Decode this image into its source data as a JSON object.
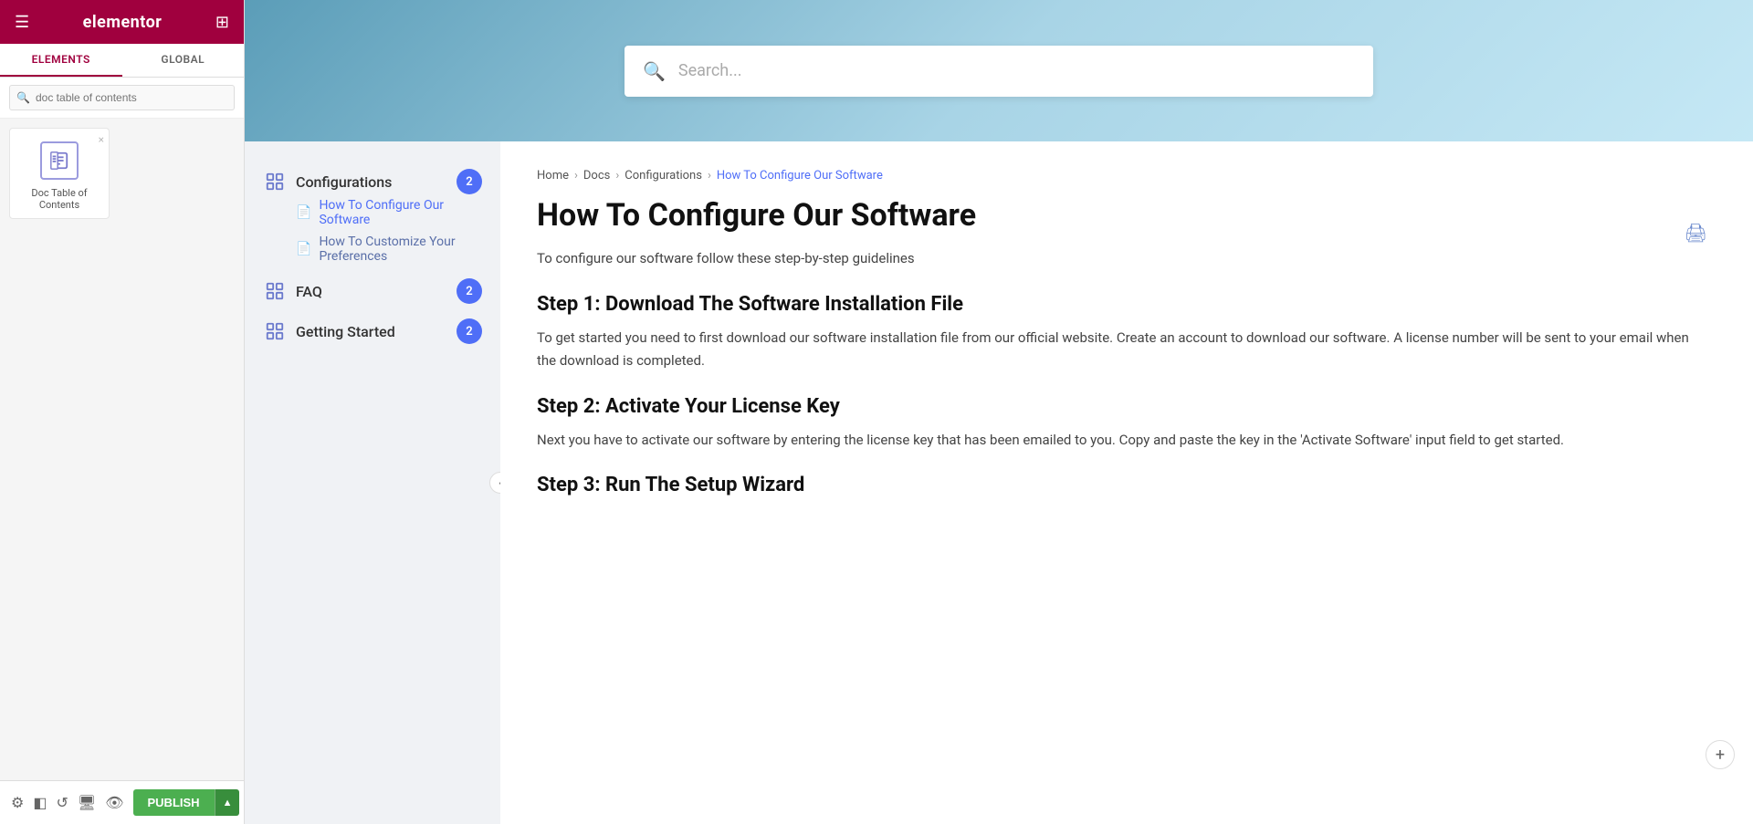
{
  "app": {
    "name": "elementor"
  },
  "left_panel": {
    "tabs": [
      {
        "label": "ELEMENTS",
        "active": true
      },
      {
        "label": "GLOBAL",
        "active": false
      }
    ],
    "search_placeholder": "doc table of contents",
    "widget": {
      "label": "Doc Table of Contents",
      "delete_icon": "×"
    },
    "footer_icons": [
      "gear",
      "layers",
      "history",
      "monitor",
      "eye"
    ],
    "publish_label": "PUBLISH"
  },
  "hero": {
    "search_placeholder": "Search..."
  },
  "breadcrumb": {
    "items": [
      "Home",
      "Docs",
      "Configurations",
      "How To Configure Our Software"
    ],
    "separators": [
      ">",
      ">",
      ">"
    ]
  },
  "doc": {
    "title": "How To Configure Our Software",
    "intro": "To configure our software follow these step-by-step guidelines",
    "sections": [
      {
        "heading": "Step 1: Download The Software Installation File",
        "text": "To get started you need to first download our software installation file from our official website. Create an account to download our software. A license number will be sent to your email when the download is completed."
      },
      {
        "heading": "Step 2: Activate Your License Key",
        "text": "Next you have to activate our software by entering the license key that has been emailed to you. Copy and paste the key in the 'Activate Software' input field to get started."
      },
      {
        "heading": "Step 3: Run The Setup Wizard",
        "text": ""
      }
    ]
  },
  "nav": {
    "categories": [
      {
        "label": "Configurations",
        "count": "2",
        "sub_items": [
          {
            "label": "How To Configure Our Software",
            "active": true
          },
          {
            "label": "How To Customize Your Preferences",
            "active": false
          }
        ]
      },
      {
        "label": "FAQ",
        "count": "2",
        "sub_items": []
      },
      {
        "label": "Getting Started",
        "count": "2",
        "sub_items": []
      }
    ]
  }
}
